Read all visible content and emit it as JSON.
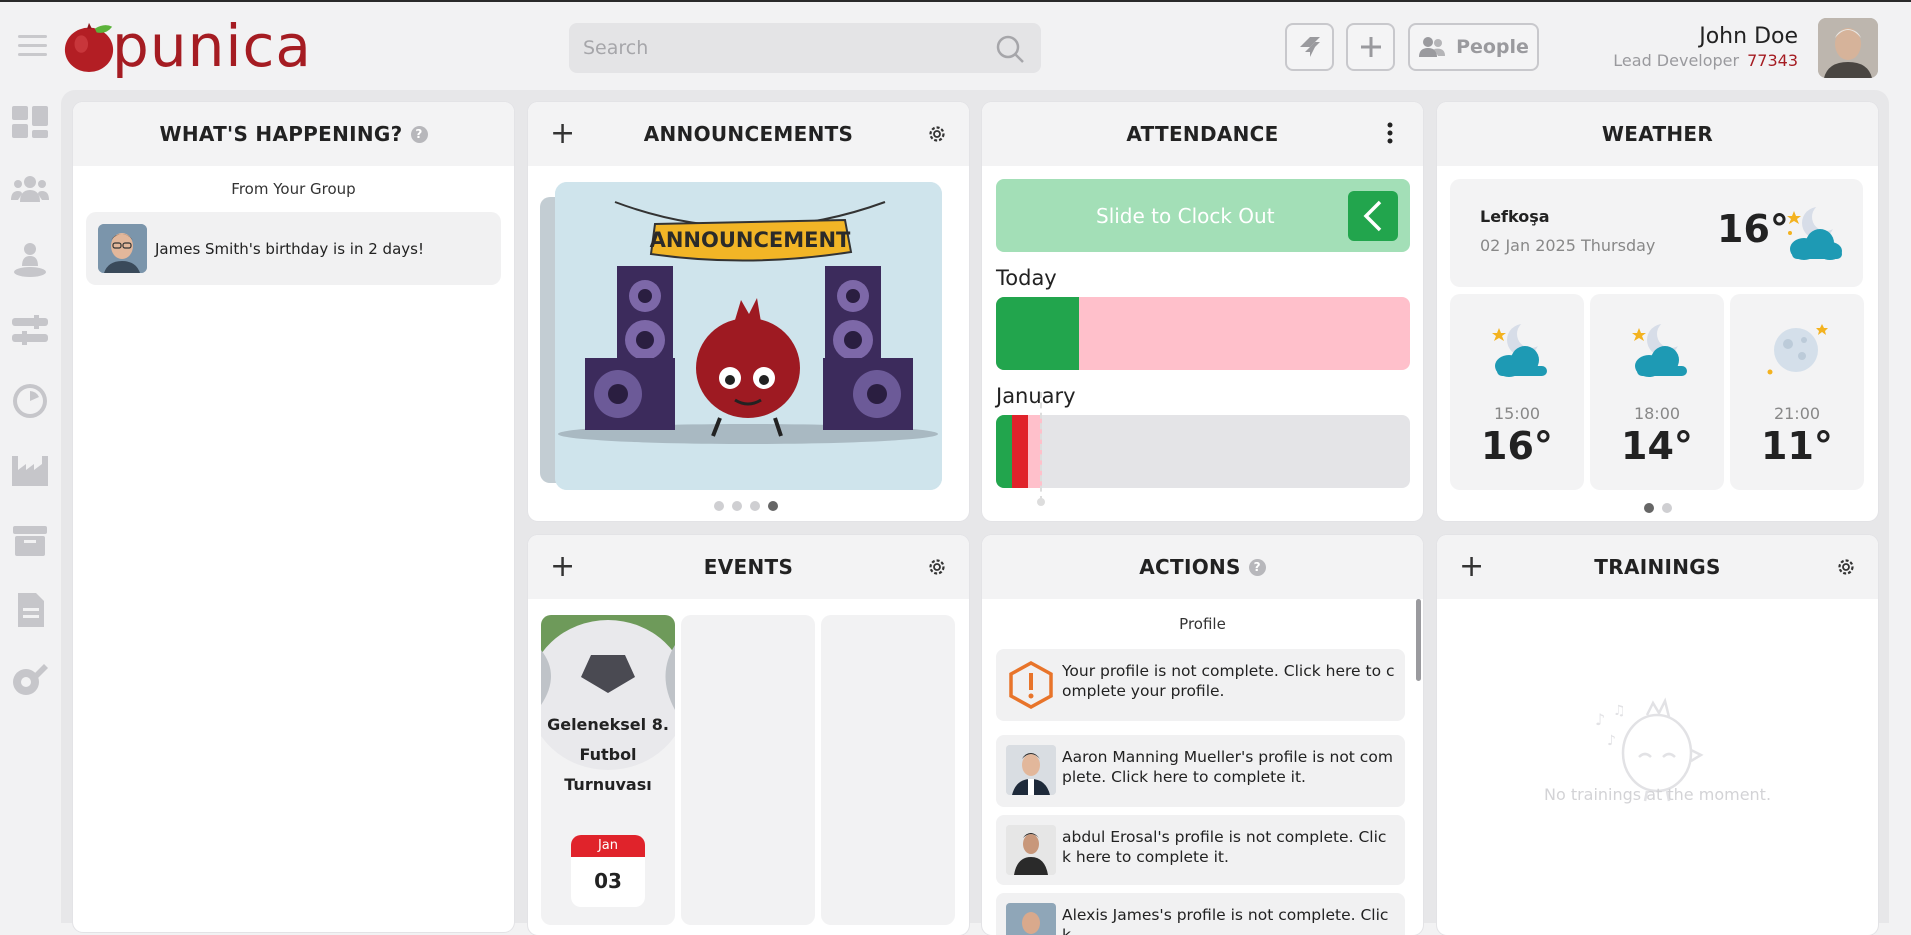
{
  "header": {
    "logo_text": "punica",
    "search_placeholder": "Search",
    "people_label": "People",
    "user": {
      "name": "John Doe",
      "role": "Lead Developer",
      "code": "77343"
    }
  },
  "sidenav": {
    "items": [
      "dashboard-icon",
      "team-icon",
      "person-icon",
      "settings-sliders-icon",
      "clock-icon",
      "factory-icon",
      "archive-icon",
      "document-icon",
      "edit-settings-icon"
    ]
  },
  "whats_happening": {
    "title": "WHAT'S HAPPENING?",
    "help": "?",
    "subtitle": "From Your Group",
    "items": [
      {
        "text": "James Smith's birthday is in 2 days!"
      }
    ]
  },
  "announcements": {
    "title": "ANNOUNCEMENTS",
    "banner_text": "ANNOUNCEMENT",
    "pages": 4,
    "active_page": 4
  },
  "attendance": {
    "title": "ATTENDANCE",
    "slide_label": "Slide to Clock Out",
    "today_label": "Today",
    "month_label": "January",
    "today_progress": 0.2,
    "colors": {
      "green": "#22a54d",
      "pink": "#ffc0cb",
      "red": "#e0232b",
      "grey": "#e4e4e7"
    }
  },
  "weather": {
    "title": "WEATHER",
    "city": "Lefkoşa",
    "date": "02 Jan 2025 Thursday",
    "temp": "16°",
    "forecast": [
      {
        "time": "15:00",
        "temp": "16°",
        "icon": "moon-cloud-icon"
      },
      {
        "time": "18:00",
        "temp": "14°",
        "icon": "moon-cloud-icon"
      },
      {
        "time": "21:00",
        "temp": "11°",
        "icon": "moon-icon"
      }
    ],
    "pages": 2,
    "active_page": 1
  },
  "events": {
    "title": "EVENTS",
    "items": [
      {
        "title_lines": [
          "Geleneksel 8.",
          "Futbol",
          "Turnuvası"
        ],
        "month": "Jan",
        "day": "03"
      }
    ]
  },
  "actions": {
    "title": "ACTIONS",
    "help": "?",
    "subtitle": "Profile",
    "items": [
      {
        "text": "Your profile is not complete. Click here to complete your profile.",
        "icon": "warning-hexagon-icon"
      },
      {
        "text": "Aaron Manning Mueller's profile is not complete. Click here to complete it.",
        "icon": "avatar"
      },
      {
        "text": "abdul Erosal's profile is not complete. Click here to complete it.",
        "icon": "avatar"
      },
      {
        "text": "Alexis James's profile is not complete. Click",
        "icon": "avatar"
      }
    ]
  },
  "trainings": {
    "title": "TRAININGS",
    "empty_text": "No trainings at the moment."
  }
}
